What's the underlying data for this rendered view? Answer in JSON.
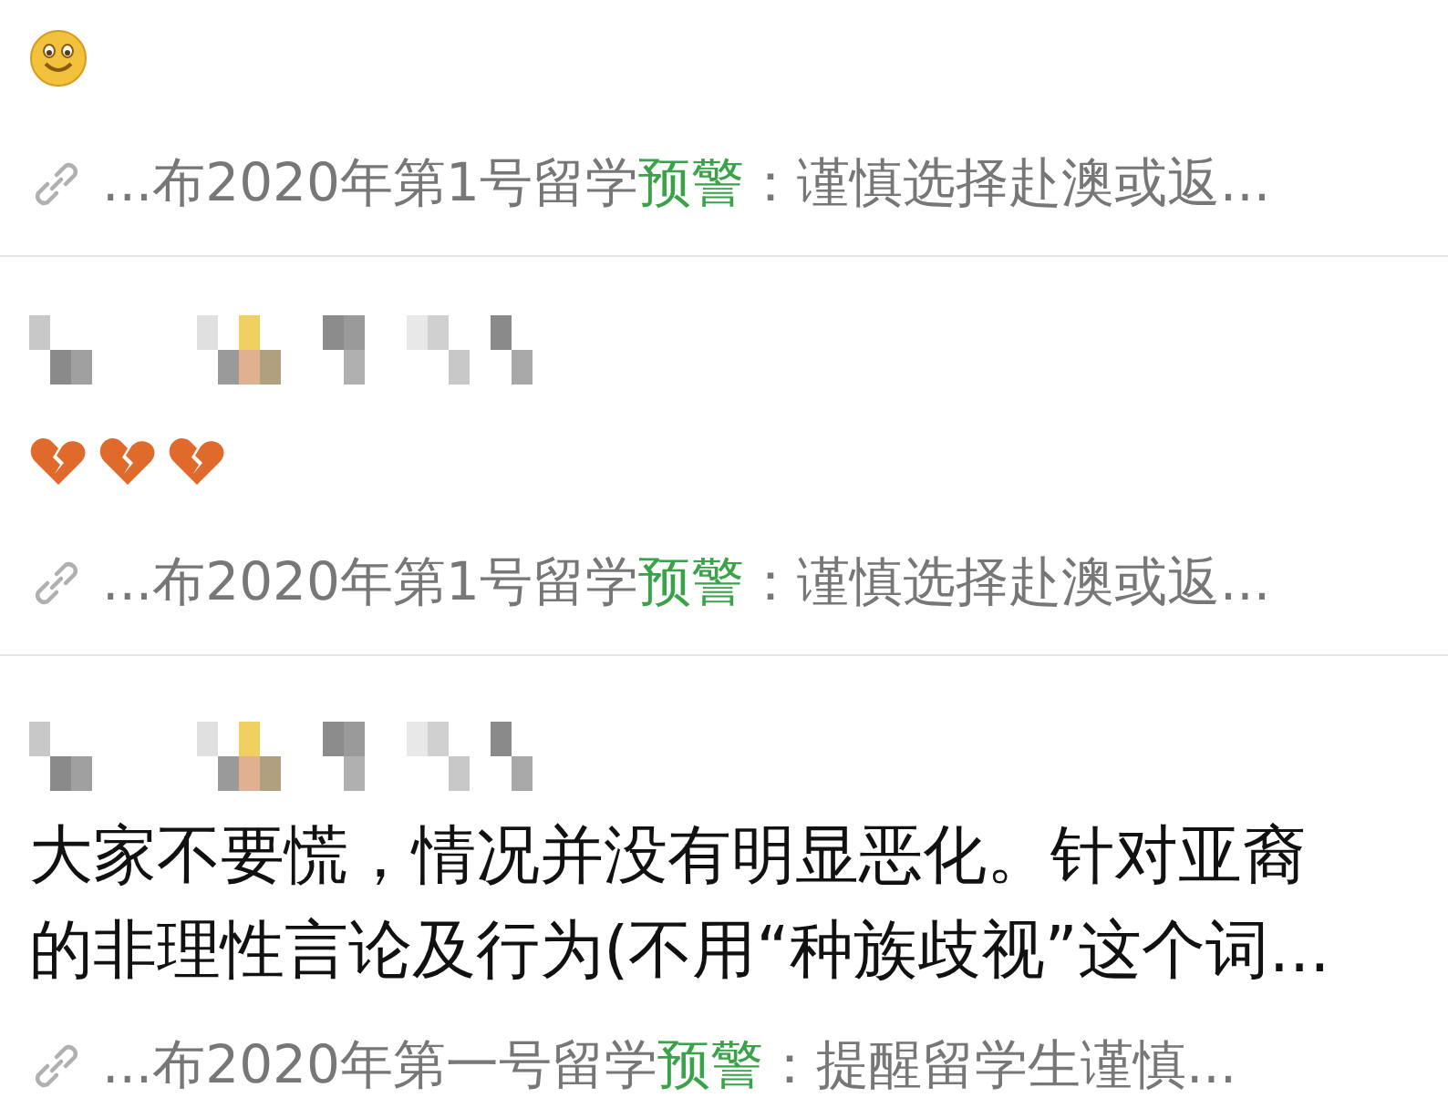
{
  "results": [
    {
      "blocks": [
        {
          "kind": "emoji",
          "emojis": [
            {
              "kind": "smiley"
            }
          ]
        }
      ],
      "link": {
        "prefix": "...布2020年第1号留学",
        "highlight": "预警",
        "suffix": "：谨慎选择赴澳或返..."
      }
    },
    {
      "blocks": [
        {
          "kind": "censored"
        },
        {
          "kind": "emoji",
          "emojis": [
            {
              "kind": "broken-heart"
            },
            {
              "kind": "broken-heart"
            },
            {
              "kind": "broken-heart"
            }
          ]
        }
      ],
      "link": {
        "prefix": "...布2020年第1号留学",
        "highlight": "预警",
        "suffix": "：谨慎选择赴澳或返..."
      }
    },
    {
      "blocks": [
        {
          "kind": "censored"
        },
        {
          "kind": "text",
          "text": "大家不要慌，情况并没有明显恶化。针对亚裔的非理性言论及行为(不用“种族歧视”这个词..."
        }
      ],
      "link": {
        "prefix": "...布2020年第一号留学",
        "highlight": "预警",
        "suffix": "：提醒留学生谨慎..."
      }
    }
  ]
}
